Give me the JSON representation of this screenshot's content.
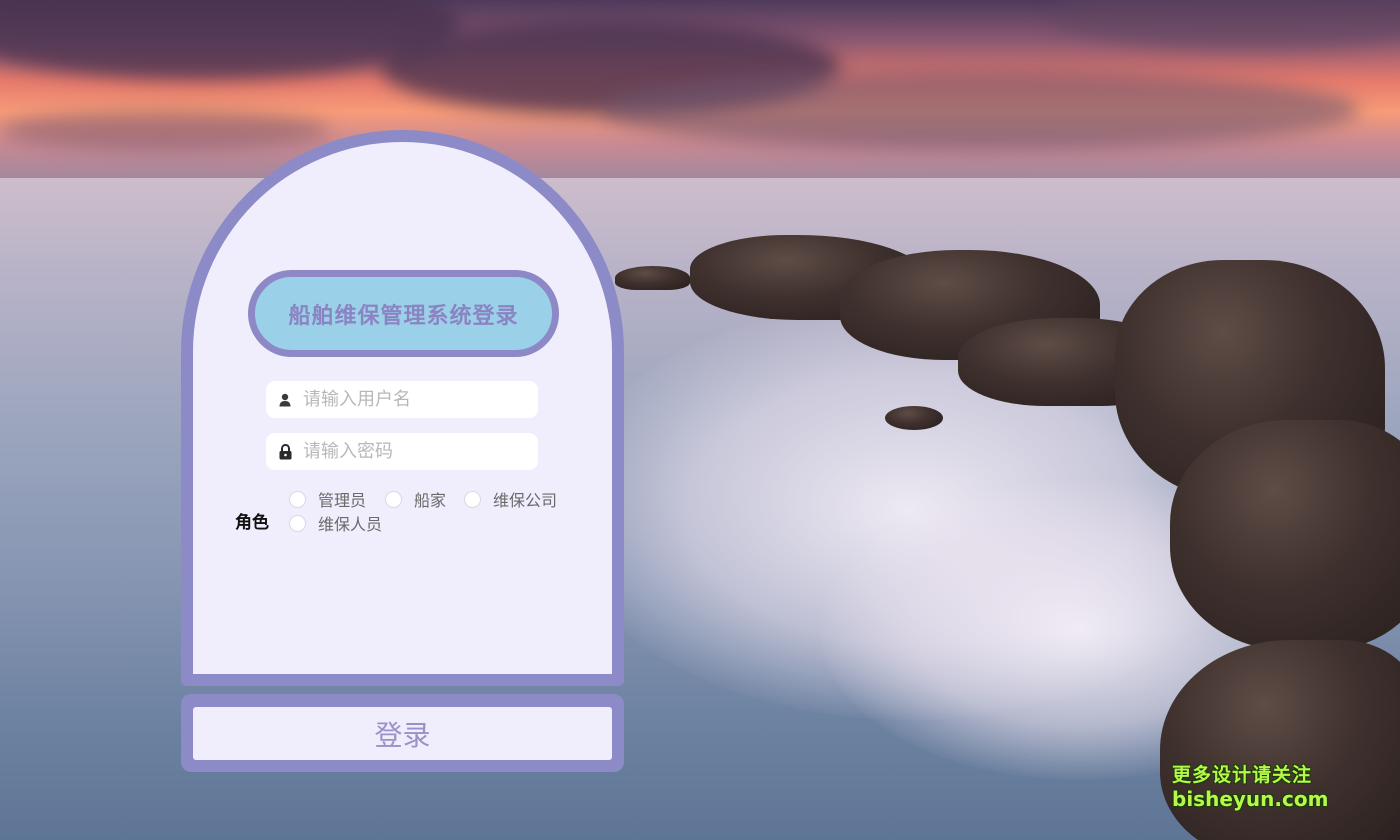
{
  "login": {
    "title": "船舶维保管理系统登录",
    "username_placeholder": "请输入用户名",
    "password_placeholder": "请输入密码",
    "role_label": "角色",
    "roles": [
      "管理员",
      "船家",
      "维保公司",
      "维保人员"
    ],
    "submit_label": "登录"
  },
  "icons": {
    "username": "user-icon",
    "password": "lock-icon"
  },
  "colors": {
    "card_border": "#8d8ac8",
    "card_background": "#f0eefc",
    "title_pill": "#9bd1e8",
    "title_text": "#8b84c3",
    "watermark": "#b4f84a"
  },
  "watermark": {
    "line1": "更多设计请关注",
    "line2": "bisheyun.com"
  }
}
